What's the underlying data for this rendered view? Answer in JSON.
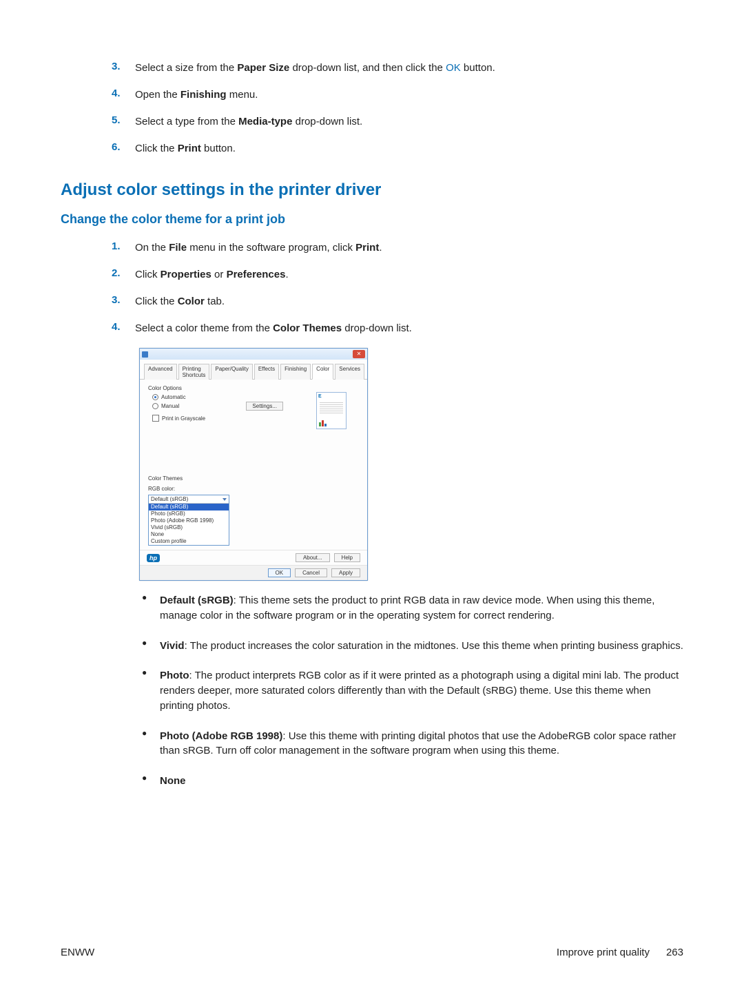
{
  "topSteps": [
    {
      "num": "3.",
      "parts": [
        "Select a size from the ",
        {
          "b": "Paper Size"
        },
        " drop-down list, and then click the ",
        {
          "link": "OK"
        },
        " button."
      ]
    },
    {
      "num": "4.",
      "parts": [
        "Open the ",
        {
          "b": "Finishing"
        },
        " menu."
      ]
    },
    {
      "num": "5.",
      "parts": [
        "Select a type from the ",
        {
          "b": "Media-type"
        },
        " drop-down list."
      ]
    },
    {
      "num": "6.",
      "parts": [
        "Click the ",
        {
          "b": "Print"
        },
        " button."
      ]
    }
  ],
  "h1": "Adjust color settings in the printer driver",
  "h2": "Change the color theme for a print job",
  "subSteps": [
    {
      "num": "1.",
      "parts": [
        "On the ",
        {
          "b": "File"
        },
        " menu in the software program, click ",
        {
          "b": "Print"
        },
        "."
      ]
    },
    {
      "num": "2.",
      "parts": [
        "Click ",
        {
          "b": "Properties"
        },
        " or ",
        {
          "b": "Preferences"
        },
        "."
      ]
    },
    {
      "num": "3.",
      "parts": [
        "Click the ",
        {
          "b": "Color"
        },
        " tab."
      ]
    },
    {
      "num": "4.",
      "parts": [
        "Select a color theme from the ",
        {
          "b": "Color Themes"
        },
        " drop-down list."
      ]
    }
  ],
  "dialog": {
    "closeGlyph": "✕",
    "tabs": [
      "Advanced",
      "Printing Shortcuts",
      "Paper/Quality",
      "Effects",
      "Finishing",
      "Color",
      "Services"
    ],
    "activeTab": "Color",
    "colorOptionsLabel": "Color Options",
    "automaticLabel": "Automatic",
    "manualLabel": "Manual",
    "settingsLabel": "Settings...",
    "grayscaleLabel": "Print in Grayscale",
    "previewLetter": "E",
    "colorThemesLabel": "Color Themes",
    "rgbColorLabel": "RGB color:",
    "selectTop": "Default (sRGB)",
    "selectOptions": [
      "Default (sRGB)",
      "Photo (sRGB)",
      "Photo (Adobe RGB 1998)",
      "Vivid (sRGB)",
      "None",
      "Custom profile"
    ],
    "selectedOption": "Default (sRGB)",
    "hpLogo": "hp",
    "aboutLabel": "About...",
    "helpLabel": "Help",
    "okLabel": "OK",
    "cancelLabel": "Cancel",
    "applyLabel": "Apply"
  },
  "themes": [
    {
      "title": "Default (sRGB)",
      "desc": ": This theme sets the product to print RGB data in raw device mode. When using this theme, manage color in the software program or in the operating system for correct rendering."
    },
    {
      "title": "Vivid",
      "desc": ": The product increases the color saturation in the midtones. Use this theme when printing business graphics."
    },
    {
      "title": "Photo",
      "desc": ": The product interprets RGB color as if it were printed as a photograph using a digital mini lab. The product renders deeper, more saturated colors differently than with the Default (sRBG) theme. Use this theme when printing photos."
    },
    {
      "title": "Photo (Adobe RGB 1998)",
      "desc": ": Use this theme with printing digital photos that use the AdobeRGB color space rather than sRGB. Turn off color management in the software program when using this theme."
    },
    {
      "title": "None",
      "desc": ""
    }
  ],
  "footer": {
    "left": "ENWW",
    "rightText": "Improve print quality",
    "pageNum": "263"
  }
}
